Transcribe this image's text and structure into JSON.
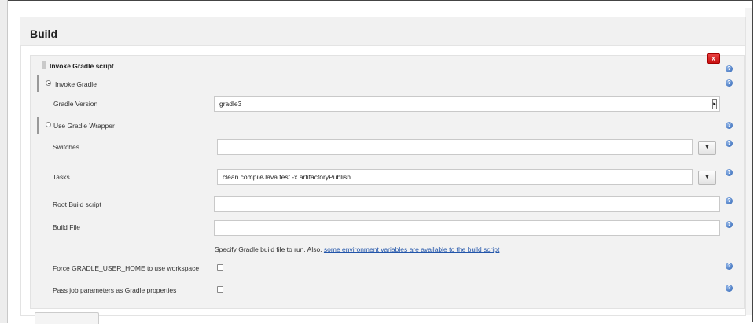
{
  "build": {
    "title": "Build",
    "step": {
      "title": "Invoke Gradle script",
      "delete_label": "X",
      "help_glyph": "?",
      "select_glyph": "▸",
      "expand_glyph": "▼",
      "invoke_gradle": {
        "label": "Invoke Gradle",
        "selected": true
      },
      "gradle_version": {
        "label": "Gradle Version",
        "value": "gradle3"
      },
      "use_wrapper": {
        "label": "Use Gradle Wrapper",
        "selected": false
      },
      "switches": {
        "label": "Switches",
        "value": ""
      },
      "tasks": {
        "label": "Tasks",
        "value": "clean compileJava  test -x artifactoryPublish"
      },
      "root_build_script": {
        "label": "Root Build script",
        "value": ""
      },
      "build_file": {
        "label": "Build File",
        "value": "",
        "hint": "Specify Gradle build file to run. Also, ",
        "hint_link": "some environment variables are available to the build script"
      },
      "force_home": {
        "label": "Force GRADLE_USER_HOME to use workspace",
        "checked": false
      },
      "pass_params": {
        "label": "Pass job parameters as Gradle properties",
        "checked": false
      }
    }
  },
  "colors": {
    "delete": "#d42020",
    "help": "#3a6fc0",
    "link": "#2255aa"
  },
  "icons": {
    "help": "help-icon",
    "delete": "close-icon",
    "drag": "drag-handle-icon",
    "expand": "chevron-down-icon"
  }
}
